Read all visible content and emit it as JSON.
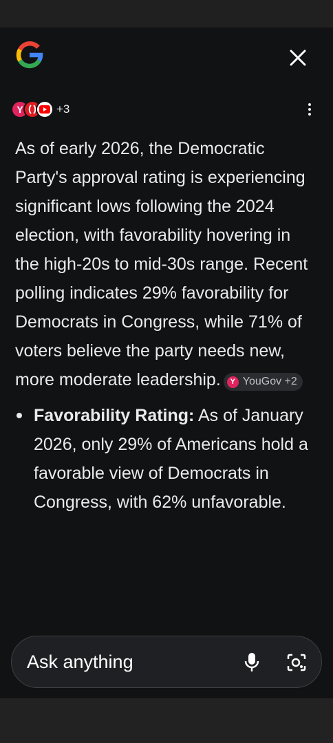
{
  "header": {
    "logo_icon": "google-g-logo-icon",
    "close_icon": "close-icon"
  },
  "sources": {
    "icons": [
      "yougov-icon",
      "red-source-icon",
      "youtube-icon"
    ],
    "more_count": "+3",
    "menu_icon": "more-vertical-icon"
  },
  "answer": {
    "paragraph": "As of early 2026, the Democratic Party's approval rating is experiencing significant lows following the 2024 election, with favorability hovering in the high-20s to mid-30s range. Recent polling indicates 29% favorability for Democrats in Congress, while 71% of voters believe the party needs new, more moderate leadership.",
    "citation": {
      "icon_letter": "Y",
      "label": "YouGov +2"
    },
    "bullets": [
      {
        "title": "Favorability Rating:",
        "text": "As of January 2026, only 29% of Americans hold a favorable view of Democrats in Congress, with 62% unfavorable."
      }
    ]
  },
  "input": {
    "placeholder": "Ask anything",
    "mic_icon": "microphone-icon",
    "lens_icon": "camera-search-icon"
  },
  "colors": {
    "sheet_background": "#111214",
    "text": "#e8eaed",
    "chip_background": "#2b2c2f",
    "yougov_brand": "#e0245e"
  }
}
